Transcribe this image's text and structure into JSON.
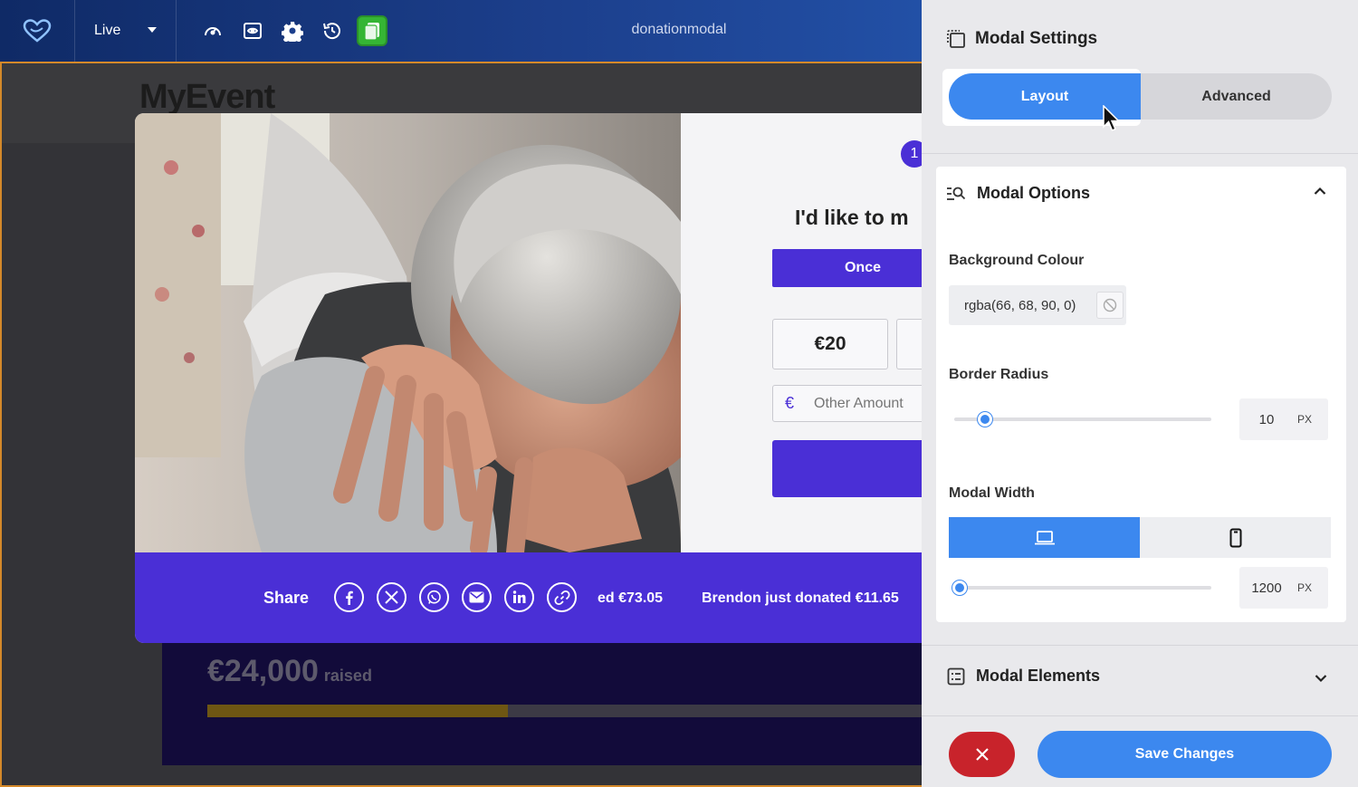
{
  "topbar": {
    "env_label": "Live",
    "doc_title": "donationmodal",
    "icons": [
      "dashboard-icon",
      "preview-icon",
      "settings-gear-icon",
      "history-icon",
      "pages-icon"
    ]
  },
  "canvas": {
    "event_title": "MyEvent",
    "raised_amount": "€24,000",
    "raised_label": "raised",
    "progress_fraction": 0.42
  },
  "modal": {
    "step_number": "1",
    "heading": "I'd like to m",
    "frequency_once": "Once",
    "amount_1": "€20",
    "currency_symbol": "€",
    "other_amount_placeholder": "Other Amount",
    "share_label": "Share",
    "share_icons": [
      "facebook-icon",
      "x-icon",
      "whatsapp-icon",
      "email-icon",
      "linkedin-icon",
      "link-icon"
    ],
    "ticker_1": "ed €73.05",
    "ticker_2": "Brendon just donated €11.65"
  },
  "panel": {
    "title": "Modal Settings",
    "tab_layout": "Layout",
    "tab_advanced": "Advanced",
    "options_title": "Modal Options",
    "bg_colour_label": "Background Colour",
    "bg_colour_value": "rgba(66, 68, 90, 0)",
    "border_radius_label": "Border Radius",
    "border_radius_value": "10",
    "border_radius_unit": "PX",
    "border_radius_fraction": 0.12,
    "modal_width_label": "Modal Width",
    "modal_width_value": "1200",
    "modal_width_unit": "PX",
    "modal_width_fraction": 0.02,
    "elements_title": "Modal Elements",
    "save_label": "Save Changes"
  },
  "colors": {
    "accent": "#3c88ef",
    "brand_purple": "#4a2fd6",
    "danger": "#c8232b",
    "active_green": "#35b534"
  }
}
